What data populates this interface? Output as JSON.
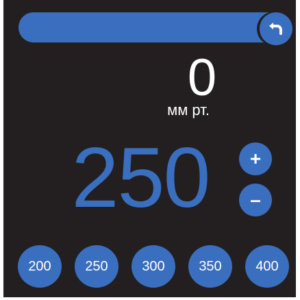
{
  "pressure": {
    "current_value": "0",
    "unit": "мм рт.",
    "setpoint": "250"
  },
  "controls": {
    "increment_label": "+",
    "decrement_label": "–"
  },
  "presets": [
    "200",
    "250",
    "300",
    "350",
    "400"
  ],
  "icons": {
    "back": "undo-arrow-icon"
  },
  "colors": {
    "background": "#231f20",
    "accent": "#3a6fbf",
    "text": "#ffffff"
  }
}
